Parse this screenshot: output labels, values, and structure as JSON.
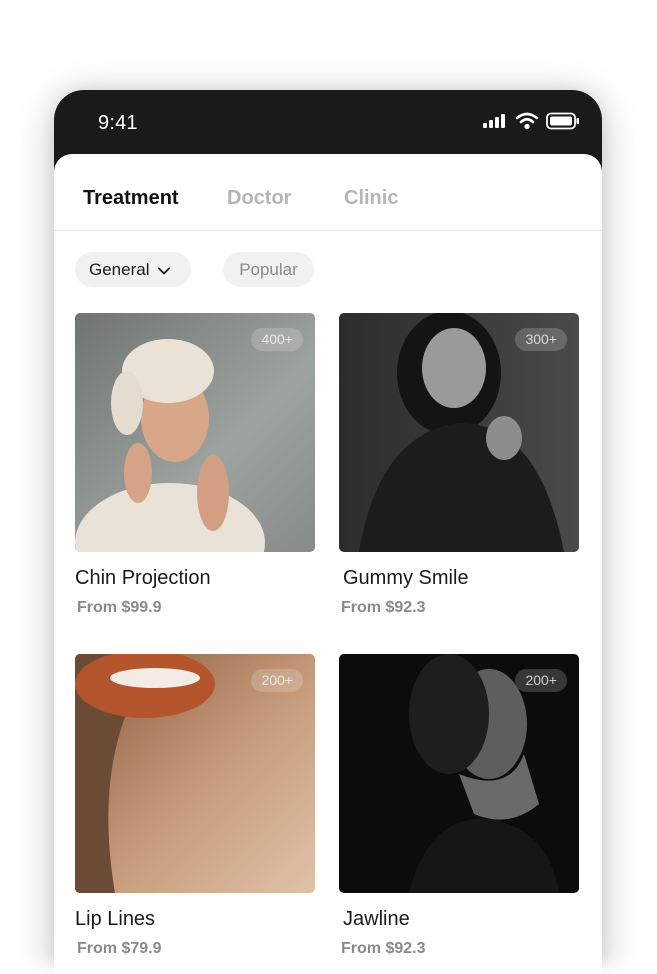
{
  "status_bar": {
    "time": "9:41",
    "icons": [
      "signal-icon",
      "wifi-icon",
      "battery-icon"
    ]
  },
  "tabs": [
    {
      "label": "Treatment",
      "active": true
    },
    {
      "label": "Doctor",
      "active": false
    },
    {
      "label": "Clinic",
      "active": false
    }
  ],
  "filters": {
    "category": {
      "label": "General",
      "icon": "chevron-down-icon"
    },
    "sort": {
      "label": "Popular"
    }
  },
  "treatments": [
    {
      "name": "Chin Projection",
      "price": "From $99.9",
      "count": "400+"
    },
    {
      "name": "Gummy Smile",
      "price": "From $92.3",
      "count": "300+"
    },
    {
      "name": "Lip Lines",
      "price": "From $79.9",
      "count": "200+"
    },
    {
      "name": "Jawline",
      "price": "From $92.3",
      "count": "200+"
    }
  ],
  "colors": {
    "status_bar_bg": "#1a1a1a",
    "active_tab": "#111111",
    "inactive_tab": "#b5b5b5",
    "chip_bg": "#f1f1f1",
    "price_text": "#8a8a8a"
  }
}
